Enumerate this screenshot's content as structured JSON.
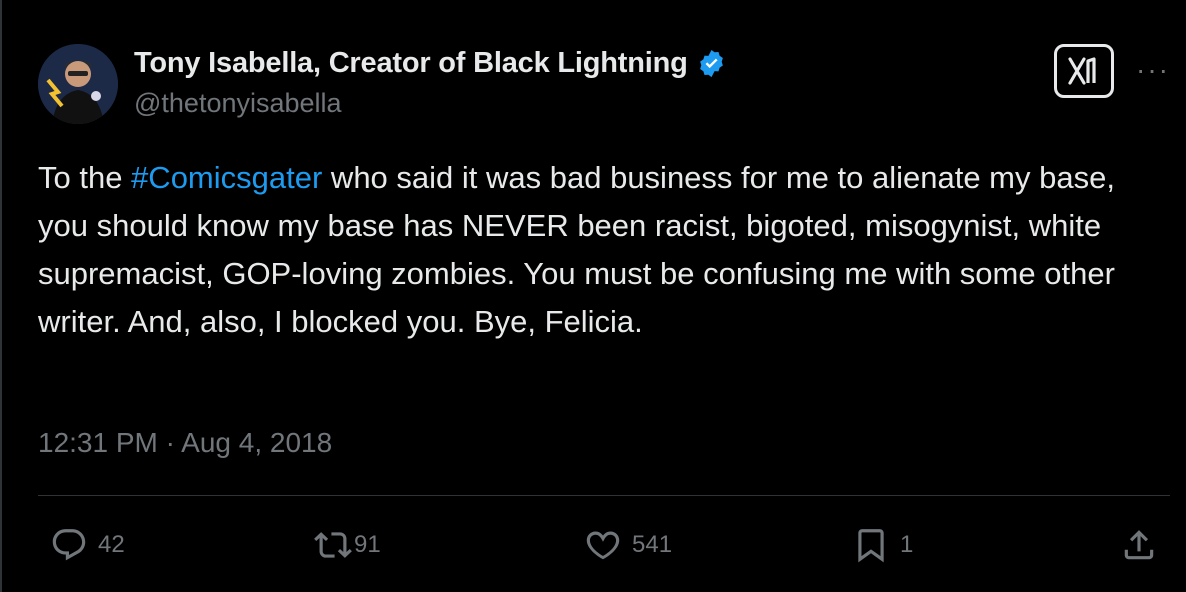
{
  "author": {
    "display_name": "Tony Isabella, Creator of Black Lightning",
    "handle": "@thetonyisabella",
    "verified": true
  },
  "tweet": {
    "text_parts": [
      "To the ",
      "#Comicsgater",
      " who said it was bad business for me to alienate my base, you should know my base has NEVER been racist, bigoted, misogynist, white supremacist, GOP-loving zombies. You must be confusing me with some other writer. And, also, I blocked you. Bye, Felicia."
    ],
    "timestamp": "12:31 PM · Aug 4, 2018"
  },
  "actions": {
    "replies": "42",
    "reposts": "91",
    "likes": "541",
    "bookmarks": "1"
  },
  "icons": {
    "verified": "verified-badge-icon",
    "logo": "x-logo-icon",
    "more": "more-icon",
    "reply": "reply-icon",
    "repost": "repost-icon",
    "like": "heart-icon",
    "bookmark": "bookmark-icon",
    "share": "share-icon"
  },
  "colors": {
    "background": "#000000",
    "text": "#e7e9ea",
    "muted": "#71767b",
    "accent": "#1d9bf0"
  }
}
